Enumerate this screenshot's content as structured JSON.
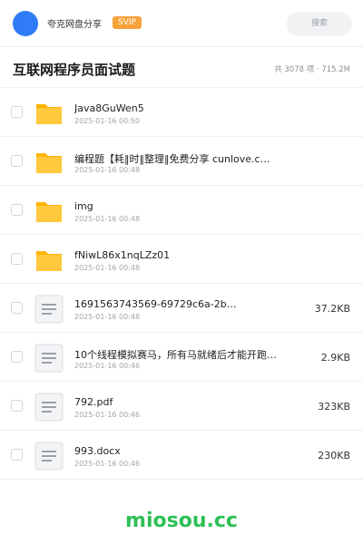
{
  "header": {
    "share_title": "夸克网盘分享",
    "badge": "SVIP",
    "search_placeholder": "搜索"
  },
  "title_bar": {
    "title": "互联网程序员面试题",
    "stats": "共 3078 项 · 715.2M"
  },
  "files": [
    {
      "type": "folder",
      "name": "Java8GuWen5",
      "date": "2025-01-16 00:50",
      "size": ""
    },
    {
      "type": "folder",
      "name": "编程题【耗‖时‖整理‖免费分享 cunlove.c…",
      "date": "2025-01-16 00:48",
      "size": ""
    },
    {
      "type": "folder",
      "name": "img",
      "date": "2025-01-16 00:48",
      "size": ""
    },
    {
      "type": "folder",
      "name": "fNiwL86x1nqLZz01",
      "date": "2025-01-16 00:48",
      "size": ""
    },
    {
      "type": "document",
      "name": "1691563743569-69729c6a-2b…",
      "date": "2025-01-16 00:48",
      "size": "37.2KB"
    },
    {
      "type": "document",
      "name": "10个线程模拟赛马，所有马就绪后才能开跑，所有马到…",
      "date": "2025-01-16 00:46",
      "size": "2.9KB"
    },
    {
      "type": "document",
      "name": "792.pdf",
      "date": "2025-01-16 00:46",
      "size": "323KB"
    },
    {
      "type": "document",
      "name": "993.docx",
      "date": "2025-01-16 00:46",
      "size": "230KB"
    }
  ],
  "icons": {
    "folder": "folder-icon",
    "document": "document-icon"
  },
  "colors": {
    "avatar": "#2f7cf6",
    "badge": "#f7a23b",
    "folder": "#ffc107",
    "brand": "#2fbf57"
  },
  "footer": {
    "brand": "miosou.cc"
  }
}
